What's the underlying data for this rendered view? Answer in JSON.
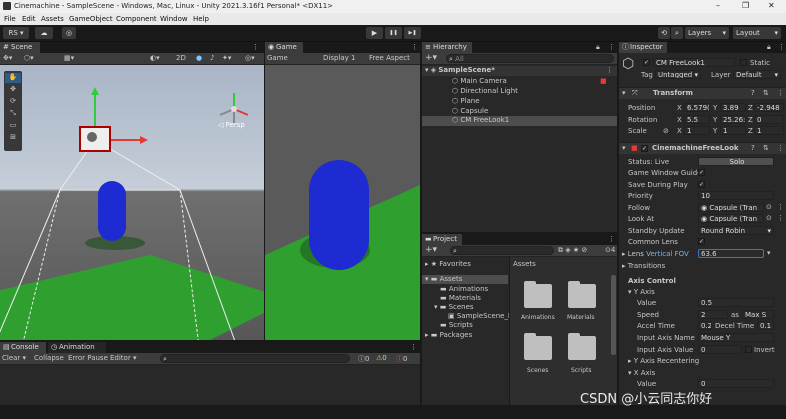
{
  "window": {
    "title": "Cinemachine - SampleScene - Windows, Mac, Linux - Unity 2021.3.16f1 Personal* <DX11>",
    "minimize": "–",
    "maximize": "❐",
    "close": "✕"
  },
  "menu": [
    "File",
    "Edit",
    "Assets",
    "GameObject",
    "Component",
    "Window",
    "Help"
  ],
  "toolbar": {
    "account": "RS",
    "play": "▶",
    "pause": "❚❚",
    "step": "▶❚",
    "layers": "Layers",
    "layout": "Layout"
  },
  "scene": {
    "tab": "Scene",
    "mode2d": "2D",
    "persp": "◁ Persp"
  },
  "game": {
    "tab": "Game",
    "view": "Game",
    "display": "Display 1",
    "aspect": "Free Aspect"
  },
  "hierarchy": {
    "tab": "Hierarchy",
    "search_placeholder": "All",
    "scene": "SampleScene*",
    "items": [
      "Main Camera",
      "Directional Light",
      "Plane",
      "Capsule",
      "CM FreeLook1"
    ]
  },
  "project": {
    "tab": "Project",
    "count": "4",
    "tree": {
      "favorites": "Favorites",
      "assets": "Assets",
      "children": [
        "Animations",
        "Materials",
        "Scenes",
        "SampleScene_P",
        "Scripts"
      ],
      "packages": "Packages"
    },
    "breadcrumb": "Assets",
    "grid": [
      "Animations",
      "Materials",
      "Scenes",
      "Scripts"
    ]
  },
  "console": {
    "tab": "Console",
    "anim_tab": "Animation",
    "clear": "Clear",
    "collapse": "Collapse",
    "error_pause": "Error Pause",
    "editor": "Editor",
    "c1": "0",
    "c2": "0",
    "c3": "0"
  },
  "inspector": {
    "tab": "Inspector",
    "name": "CM FreeLook1",
    "static": "Static",
    "tag_label": "Tag",
    "tag": "Untagged",
    "layer_label": "Layer",
    "layer": "Default",
    "transform": {
      "title": "Transform",
      "position": [
        "6.579(",
        "3.89",
        "-2.948"
      ],
      "rotation": [
        "5.5",
        "25.26:",
        "0"
      ],
      "scale": [
        "1",
        "1",
        "1"
      ],
      "labels": [
        "Position",
        "Rotation",
        "Scale"
      ]
    },
    "freelook": {
      "title": "CinemachineFreeLook",
      "status_label": "Status: Live",
      "solo": "Solo",
      "rows": [
        {
          "label": "Game Window Guides",
          "value": "✓"
        },
        {
          "label": "Save During Play",
          "value": "✓"
        },
        {
          "label": "Priority",
          "value": "10"
        },
        {
          "label": "Follow",
          "value": "◉ Capsule (Tran"
        },
        {
          "label": "Look At",
          "value": "◉ Capsule (Tran"
        },
        {
          "label": "Standby Update",
          "value": "Round Robin"
        },
        {
          "label": "Common Lens",
          "value": "✓"
        }
      ],
      "lens_label": "Lens",
      "lens_mode": "Vertical FOV",
      "lens_value": "63.6",
      "transitions": "Transitions",
      "axis_control": "Axis Control",
      "yaxis": "Y Axis",
      "y_value_label": "Value",
      "y_value": "0.5",
      "speed_label": "Speed",
      "speed": "2",
      "as": "as",
      "speed_mode": "Max S",
      "accel_label": "Accel Time",
      "accel": "0.2",
      "decel_label": "Decel Time",
      "decel": "0.1",
      "input_name_label": "Input Axis Name",
      "input_name": "Mouse Y",
      "input_value_label": "Input Axis Value",
      "input_value": "0",
      "invert": "Invert",
      "recentering": "Y Axis Recentering",
      "xaxis": "X Axis",
      "x_value_label": "Value",
      "x_value": "0"
    }
  },
  "watermark": "CSDN @小云同志你好",
  "colors": {
    "accent": "#2c5d87",
    "ground": "#2fa02f",
    "capsule": "#1e2ad2"
  }
}
